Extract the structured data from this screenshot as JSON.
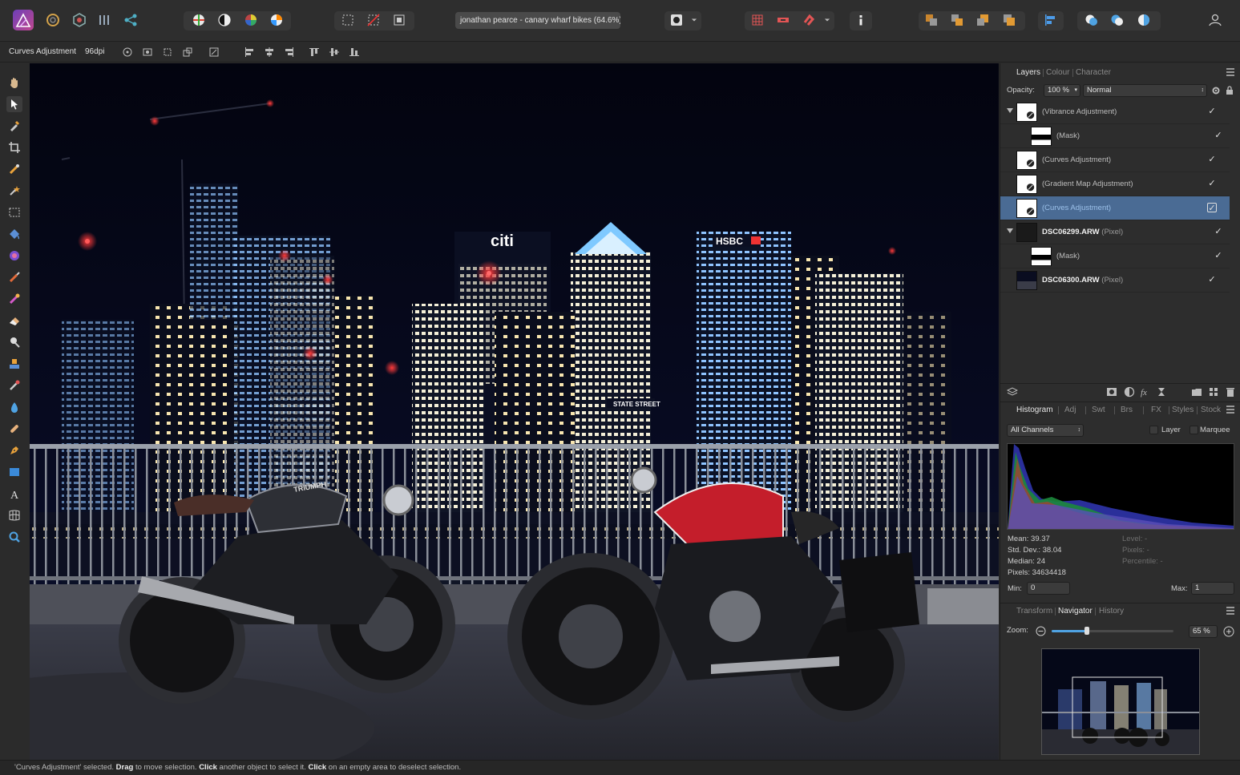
{
  "app": {
    "name": "Affinity Photo",
    "icon": "affinity-photo-logo-icon"
  },
  "toolbar": {
    "document_title": "jonathan pearce - canary wharf bikes (64.6%)",
    "personas": [
      "photo-persona-icon",
      "liquify-persona-icon",
      "develop-persona-icon",
      "tone-mapping-persona-icon",
      "export-persona-icon"
    ],
    "adjustment_icons": [
      "levels-icon",
      "contrast-icon",
      "colour-wheel-icon",
      "white-balance-icon"
    ],
    "selection_icons": [
      "marquee-selection-icon",
      "deselect-icon",
      "invert-selection-icon"
    ],
    "quickmask_icon": "quick-mask-icon",
    "snapping_icons": [
      "grid-icon",
      "assistant-icon",
      "snapping-magnet-icon"
    ],
    "info_icon": "info-icon",
    "arrange_icons": [
      "move-back-icon",
      "move-forward-icon",
      "move-to-back-icon",
      "move-to-front-icon"
    ],
    "align_icon": "align-left-icon",
    "boolean_icons": [
      "add-icon",
      "subtract-icon",
      "intersect-icon"
    ],
    "user_icon": "user-icon"
  },
  "context": {
    "layer_label": "Curves Adjustment",
    "dpi": "96dpi"
  },
  "tools": [
    "hand-tool-icon",
    "move-tool-icon",
    "colour-picker-tool-icon",
    "crop-tool-icon",
    "selection-brush-tool-icon",
    "flood-select-tool-icon",
    "rectangle-marquee-tool-icon",
    "flood-fill-tool-icon",
    "gradient-tool-icon",
    "paint-brush-tool-icon",
    "colour-replacement-tool-icon",
    "erase-brush-tool-icon",
    "dodge-tool-icon",
    "clone-tool-icon",
    "blemish-tool-icon",
    "blur-brush-tool-icon",
    "healing-brush-tool-icon",
    "pen-tool-icon",
    "rectangle-tool-icon",
    "text-tool-icon",
    "mesh-warp-tool-icon",
    "zoom-tool-icon"
  ],
  "layers_panel": {
    "tabs": [
      "Layers",
      "Colour",
      "Character"
    ],
    "opacity_label": "Opacity:",
    "opacity_value": "100 %",
    "blend_mode": "Normal",
    "layers": [
      {
        "name": "(Vibrance Adjustment)",
        "kind": "",
        "bold": false,
        "expanded": true,
        "indent": 0,
        "checked": true,
        "selected": false,
        "thumb": "adjustment"
      },
      {
        "name": "(Mask)",
        "kind": "",
        "bold": false,
        "expanded": null,
        "indent": 1,
        "checked": true,
        "selected": false,
        "thumb": "mask"
      },
      {
        "name": "(Curves Adjustment)",
        "kind": "",
        "bold": false,
        "expanded": null,
        "indent": 0,
        "checked": true,
        "selected": false,
        "thumb": "adjustment"
      },
      {
        "name": "(Gradient Map Adjustment)",
        "kind": "",
        "bold": false,
        "expanded": null,
        "indent": 0,
        "checked": true,
        "selected": false,
        "thumb": "adjustment"
      },
      {
        "name": "(Curves Adjustment)",
        "kind": "",
        "bold": false,
        "expanded": null,
        "indent": 0,
        "checked": true,
        "selected": true,
        "thumb": "adjustment"
      },
      {
        "name": "DSC06299.ARW",
        "kind": "(Pixel)",
        "bold": true,
        "expanded": true,
        "indent": 0,
        "checked": true,
        "selected": false,
        "thumb": "dark"
      },
      {
        "name": "(Mask)",
        "kind": "",
        "bold": false,
        "expanded": null,
        "indent": 1,
        "checked": true,
        "selected": false,
        "thumb": "mask"
      },
      {
        "name": "DSC06300.ARW",
        "kind": "(Pixel)",
        "bold": true,
        "expanded": null,
        "indent": 0,
        "checked": true,
        "selected": false,
        "thumb": "photo"
      }
    ],
    "footer_icons": [
      "layers-stack-icon",
      "mask-icon",
      "adjustment-icon",
      "fx-icon",
      "live-filter-icon",
      "group-folder-icon",
      "pixel-layer-icon",
      "trash-icon"
    ]
  },
  "histogram_panel": {
    "tabs": [
      "Histogram",
      "Adj",
      "Swt",
      "Brs",
      "FX",
      "Styles",
      "Stock"
    ],
    "channel": "All Channels",
    "layer_label": "Layer",
    "marquee_label": "Marquee",
    "stats_left": [
      "Mean: 39.37",
      "Std. Dev.: 38.04",
      "Median: 24",
      "Pixels: 34634418"
    ],
    "stats_right": [
      "Level: -",
      "Pixels: -",
      "Percentile: -"
    ],
    "min_label": "Min:",
    "min_value": "0",
    "max_label": "Max:",
    "max_value": "1"
  },
  "navigator_panel": {
    "tabs": [
      "Transform",
      "Navigator",
      "History"
    ],
    "zoom_label": "Zoom:",
    "zoom_value": "65 %",
    "zoom_fraction": 0.65
  },
  "status": {
    "p1": "'Curves Adjustment' selected. ",
    "b1": "Drag",
    "p2": " to move selection. ",
    "b2": "Click",
    "p3": " another object to select it. ",
    "b3": "Click",
    "p4": " on an empty area to deselect selection."
  },
  "photo_signs": {
    "citi": "citi",
    "hsbc": "HSBC",
    "state_street": "STATE STREET",
    "triumph": "TRIUMPH"
  }
}
